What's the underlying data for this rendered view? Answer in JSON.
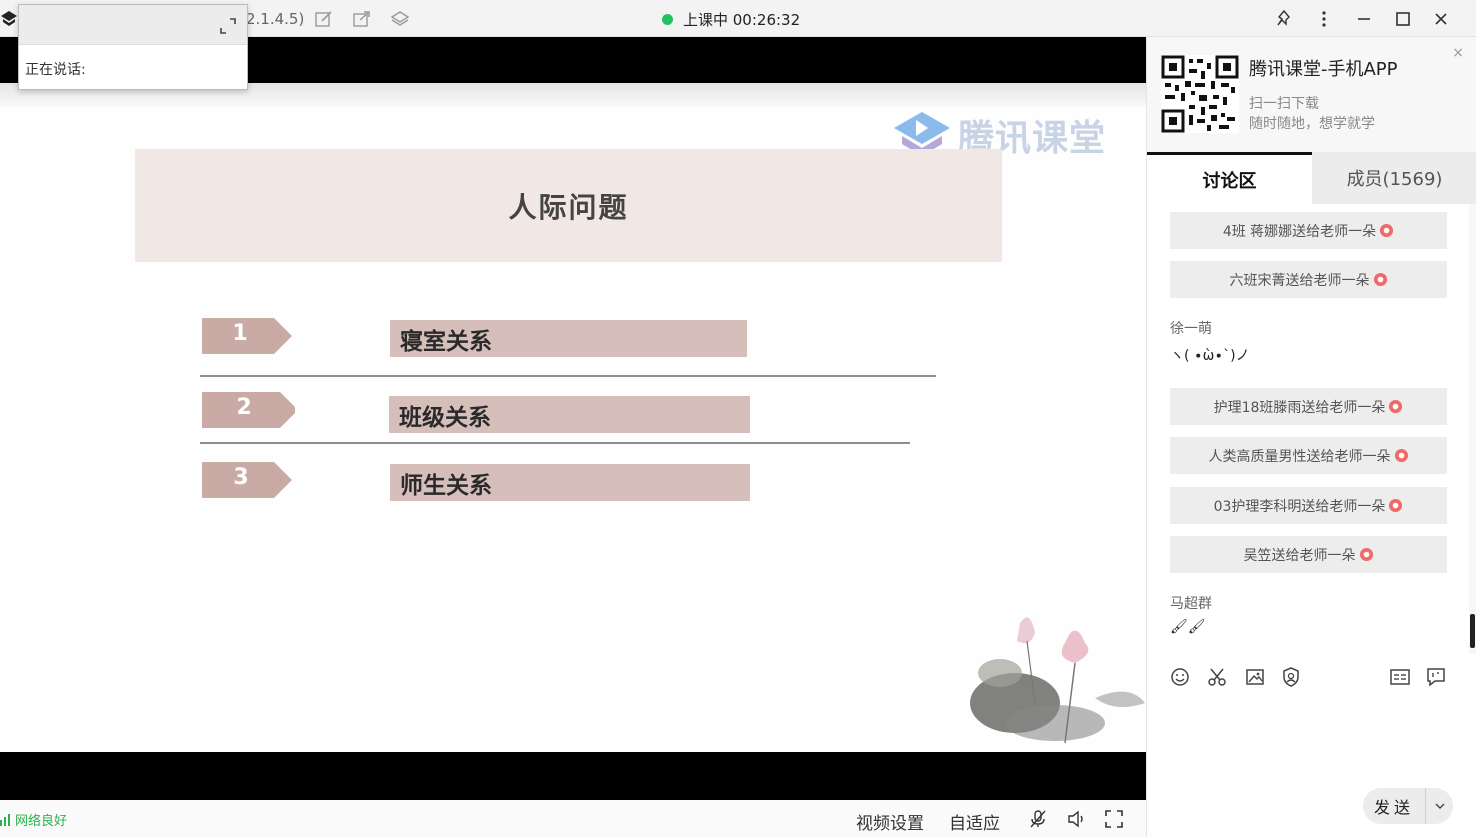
{
  "titlebar": {
    "version_text": "2.1.4.5)",
    "status_text": "上课中 00:26:32",
    "status_color": "#22c35e",
    "icons": [
      "edit-icon",
      "share-icon",
      "layers-icon",
      "pin-icon",
      "more-icon",
      "minimize-icon",
      "maximize-icon",
      "close-icon"
    ]
  },
  "speaker_panel": {
    "speaking_label": "正在说话:"
  },
  "slide": {
    "watermark_text": "腾讯课堂",
    "title": "人际问题",
    "items": [
      {
        "num": "1",
        "label": "寝室关系"
      },
      {
        "num": "2",
        "label": "班级关系"
      },
      {
        "num": "3",
        "label": "师生关系"
      }
    ]
  },
  "bottombar": {
    "network_status": "网络良好",
    "video_settings": "视频设置",
    "adaptive": "自适应"
  },
  "right_panel": {
    "app_title": "腾讯课堂-手机APP",
    "app_sub1": "扫一扫下载",
    "app_sub2": "随时随地，想学就学",
    "close": "×",
    "tabs": [
      {
        "label": "讨论区",
        "active": true
      },
      {
        "label": "成员(1569)",
        "active": false
      }
    ],
    "chat": [
      {
        "type": "gift",
        "text": "4班 蒋娜娜送给老师一朵"
      },
      {
        "type": "gift",
        "text": "六班宋菁送给老师一朵"
      },
      {
        "type": "message",
        "name": "徐一萌",
        "text": "ヽ( ∙ὼ∙`)ノ"
      },
      {
        "type": "gift",
        "text": "护理18班滕雨送给老师一朵"
      },
      {
        "type": "gift",
        "text": "人类高质量男性送给老师一朵"
      },
      {
        "type": "gift",
        "text": "03护理李科明送给老师一朵"
      },
      {
        "type": "gift",
        "text": "吴笠送给老师一朵"
      },
      {
        "type": "message",
        "name": "马超群",
        "text": "🖌🖌"
      }
    ],
    "send_label": "发送",
    "flower_color": "#f06a6a"
  }
}
